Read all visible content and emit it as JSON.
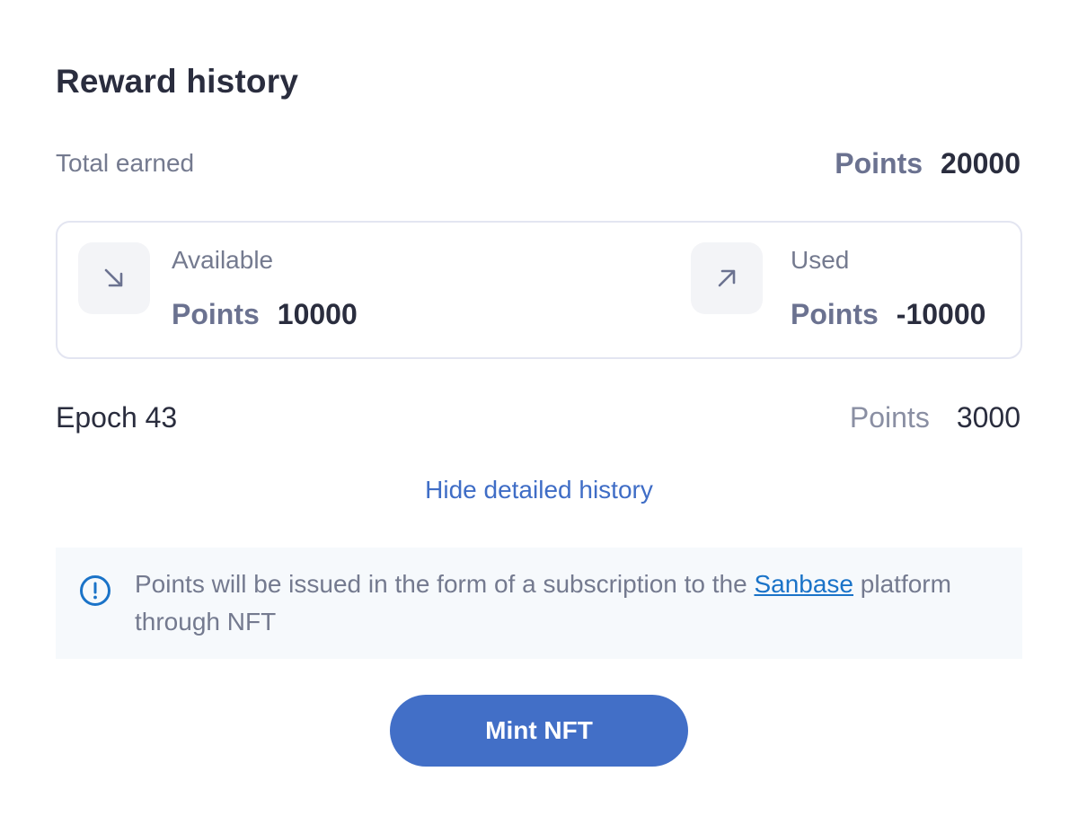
{
  "header": {
    "title": "Reward history"
  },
  "total": {
    "label": "Total earned",
    "points_word": "Points",
    "value": "20000"
  },
  "balance": {
    "available": {
      "label": "Available",
      "icon": "arrow-down-right-icon",
      "points_word": "Points",
      "value": "10000"
    },
    "used": {
      "label": "Used",
      "icon": "arrow-up-right-icon",
      "points_word": "Points",
      "value": "-10000"
    }
  },
  "epoch": {
    "name": "Epoch 43",
    "points_word": "Points",
    "value": "3000"
  },
  "toggle": {
    "label": "Hide detailed history"
  },
  "notice": {
    "icon": "info-exclamation-icon",
    "text_before": "Points will be issued in the form of a subscription to the ",
    "link_text": "Sanbase",
    "text_after": " platform through NFT"
  },
  "actions": {
    "mint_label": "Mint NFT"
  },
  "colors": {
    "accent": "#426fc7",
    "link": "#1a73c8",
    "text_dark": "#2a2d3e",
    "text_muted": "#747a8f"
  }
}
